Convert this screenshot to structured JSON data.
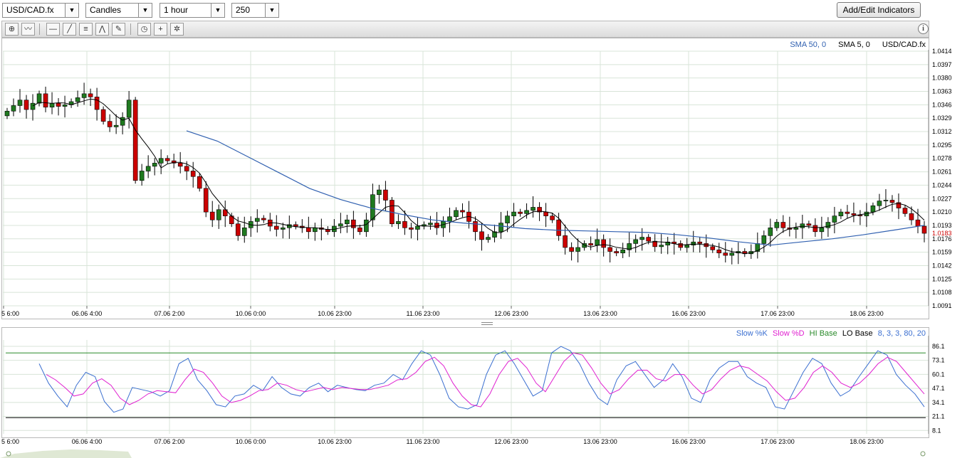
{
  "controls": {
    "symbol": "USD/CAD.fx",
    "chart_type": "Candles",
    "timeframe": "1 hour",
    "bars": "250",
    "add_indicators_label": "Add/Edit Indicators"
  },
  "toolbar": {
    "icons": [
      "crosshair-icon",
      "chart-style-icon",
      "horizontal-line-icon",
      "trend-line-icon",
      "fibonacci-icon",
      "pattern-icon",
      "eraser-icon",
      "clock-icon",
      "add-chart-icon",
      "settings-icon"
    ],
    "info_label": "i"
  },
  "price_panel": {
    "legend": {
      "sma50": "SMA 50, 0",
      "sma5": "SMA 5, 0",
      "symbol": "USD/CAD.fx"
    },
    "y_labels": [
      "1.0414",
      "1.0397",
      "1.0380",
      "1.0363",
      "1.0346",
      "1.0329",
      "1.0312",
      "1.0295",
      "1.0278",
      "1.0261",
      "1.0244",
      "1.0227",
      "1.0210",
      "1.0193",
      "1.0176",
      "1.0159",
      "1.0142",
      "1.0125",
      "1.0108",
      "1.0091"
    ],
    "current_price": "1.0183",
    "x_labels": [
      "5 6:00",
      "06.06 4:00",
      "07.06 2:00",
      "10.06 0:00",
      "10.06 23:00",
      "11.06 23:00",
      "12.06 23:00",
      "13.06 23:00",
      "16.06 23:00",
      "17.06 23:00",
      "18.06 23:00"
    ]
  },
  "stoch_panel": {
    "legend": {
      "k": "Slow %K",
      "d": "Slow %D",
      "hi": "HI Base",
      "lo": "LO Base",
      "params": "8, 3, 3, 80, 20"
    },
    "y_labels": [
      "86.1",
      "73.1",
      "60.1",
      "47.1",
      "34.1",
      "21.1",
      "8.1"
    ],
    "x_labels": [
      "5 6:00",
      "06.06 4:00",
      "07.06 2:00",
      "10.06 0:00",
      "10.06 23:00",
      "11.06 23:00",
      "12.06 23:00",
      "13.06 23:00",
      "16.06 23:00",
      "17.06 23:00",
      "18.06 23:00"
    ]
  },
  "colors": {
    "up": "#1f7a1f",
    "down": "#cc0000",
    "sma50": "#3060b0",
    "sma5": "#000000",
    "k": "#3b6fd0",
    "d": "#e020d0",
    "hi": "#2a8a2a",
    "lo": "#000000",
    "grid": "#d8e4d8"
  },
  "chart_data": [
    {
      "type": "candlestick",
      "y_range": [
        1.0091,
        1.0414
      ],
      "closes": [
        1.0338,
        1.0345,
        1.0352,
        1.034,
        1.0348,
        1.036,
        1.0343,
        1.0348,
        1.0344,
        1.0346,
        1.035,
        1.0355,
        1.036,
        1.0356,
        1.034,
        1.0325,
        1.0318,
        1.032,
        1.033,
        1.0352,
        1.025,
        1.0262,
        1.0268,
        1.0272,
        1.0278,
        1.0275,
        1.0272,
        1.0268,
        1.0262,
        1.0255,
        1.024,
        1.021,
        1.02,
        1.0213,
        1.0205,
        1.0195,
        1.018,
        1.019,
        1.0198,
        1.0202,
        1.02,
        1.0192,
        1.0188,
        1.019,
        1.0194,
        1.0192,
        1.019,
        1.0185,
        1.019,
        1.0188,
        1.0185,
        1.0192,
        1.0195,
        1.02,
        1.019,
        1.0185,
        1.02,
        1.0232,
        1.0238,
        1.0225,
        1.0195,
        1.0198,
        1.019,
        1.0188,
        1.0192,
        1.0194,
        1.0196,
        1.019,
        1.0198,
        1.0204,
        1.0212,
        1.021,
        1.0198,
        1.0185,
        1.0175,
        1.0178,
        1.0185,
        1.0196,
        1.0205,
        1.021,
        1.0208,
        1.0212,
        1.0216,
        1.021,
        1.0205,
        1.02,
        1.018,
        1.0165,
        1.016,
        1.0165,
        1.017,
        1.0168,
        1.0175,
        1.0165,
        1.016,
        1.0158,
        1.0162,
        1.017,
        1.0175,
        1.0178,
        1.0173,
        1.0166,
        1.0168,
        1.0172,
        1.017,
        1.0165,
        1.0168,
        1.0172,
        1.017,
        1.0166,
        1.0162,
        1.0158,
        1.0155,
        1.0158,
        1.016,
        1.0157,
        1.016,
        1.017,
        1.018,
        1.019,
        1.0197,
        1.019,
        1.0188,
        1.019,
        1.0195,
        1.0193,
        1.0185,
        1.019,
        1.0197,
        1.0205,
        1.021,
        1.0208,
        1.0206,
        1.0205,
        1.021,
        1.0218,
        1.0224,
        1.0225,
        1.0222,
        1.0215,
        1.0208,
        1.02,
        1.0192,
        1.0183
      ],
      "sma50": [
        1.0313,
        1.03,
        1.028,
        1.026,
        1.024,
        1.0226,
        1.0215,
        1.0207,
        1.02,
        1.0196,
        1.0193,
        1.0189,
        1.0187,
        1.0186,
        1.0185,
        1.0184,
        1.0181,
        1.0177,
        1.0172,
        1.0168,
        1.0172,
        1.0176,
        1.0181,
        1.0187,
        1.0193
      ]
    },
    {
      "type": "line",
      "series": [
        {
          "name": "Slow %K",
          "values": [
            70,
            52,
            40,
            30,
            50,
            62,
            58,
            35,
            25,
            28,
            48,
            46,
            44,
            40,
            45,
            70,
            75,
            55,
            45,
            32,
            30,
            40,
            42,
            50,
            45,
            58,
            48,
            42,
            40,
            48,
            52,
            44,
            50,
            48,
            46,
            45,
            50,
            52,
            60,
            55,
            70,
            82,
            78,
            60,
            38,
            30,
            28,
            32,
            60,
            78,
            82,
            70,
            55,
            40,
            45,
            80,
            86,
            82,
            70,
            52,
            38,
            32,
            55,
            68,
            72,
            60,
            48,
            55,
            70,
            58,
            38,
            34,
            55,
            66,
            72,
            72,
            58,
            52,
            48,
            30,
            28,
            45,
            62,
            75,
            70,
            52,
            40,
            45,
            58,
            70,
            82,
            78,
            60,
            50,
            42,
            30
          ]
        },
        {
          "name": "Slow %D",
          "values": [
            60,
            55,
            48,
            40,
            42,
            52,
            56,
            50,
            38,
            32,
            36,
            42,
            45,
            44,
            43,
            55,
            65,
            62,
            52,
            40,
            34,
            36,
            40,
            45,
            46,
            52,
            50,
            46,
            44,
            46,
            48,
            46,
            48,
            47,
            46,
            46,
            48,
            50,
            55,
            56,
            62,
            72,
            76,
            68,
            52,
            40,
            32,
            30,
            42,
            60,
            72,
            75,
            66,
            52,
            44,
            58,
            72,
            80,
            78,
            66,
            52,
            42,
            46,
            56,
            64,
            64,
            56,
            54,
            60,
            60,
            50,
            42,
            46,
            56,
            64,
            68,
            66,
            60,
            54,
            44,
            36,
            38,
            48,
            62,
            68,
            62,
            52,
            48,
            52,
            60,
            70,
            76,
            72,
            62,
            52,
            42
          ]
        },
        {
          "name": "HI Base",
          "values": [
            80
          ]
        },
        {
          "name": "LO Base",
          "values": [
            20
          ]
        }
      ],
      "y_range": [
        5,
        92
      ]
    }
  ]
}
